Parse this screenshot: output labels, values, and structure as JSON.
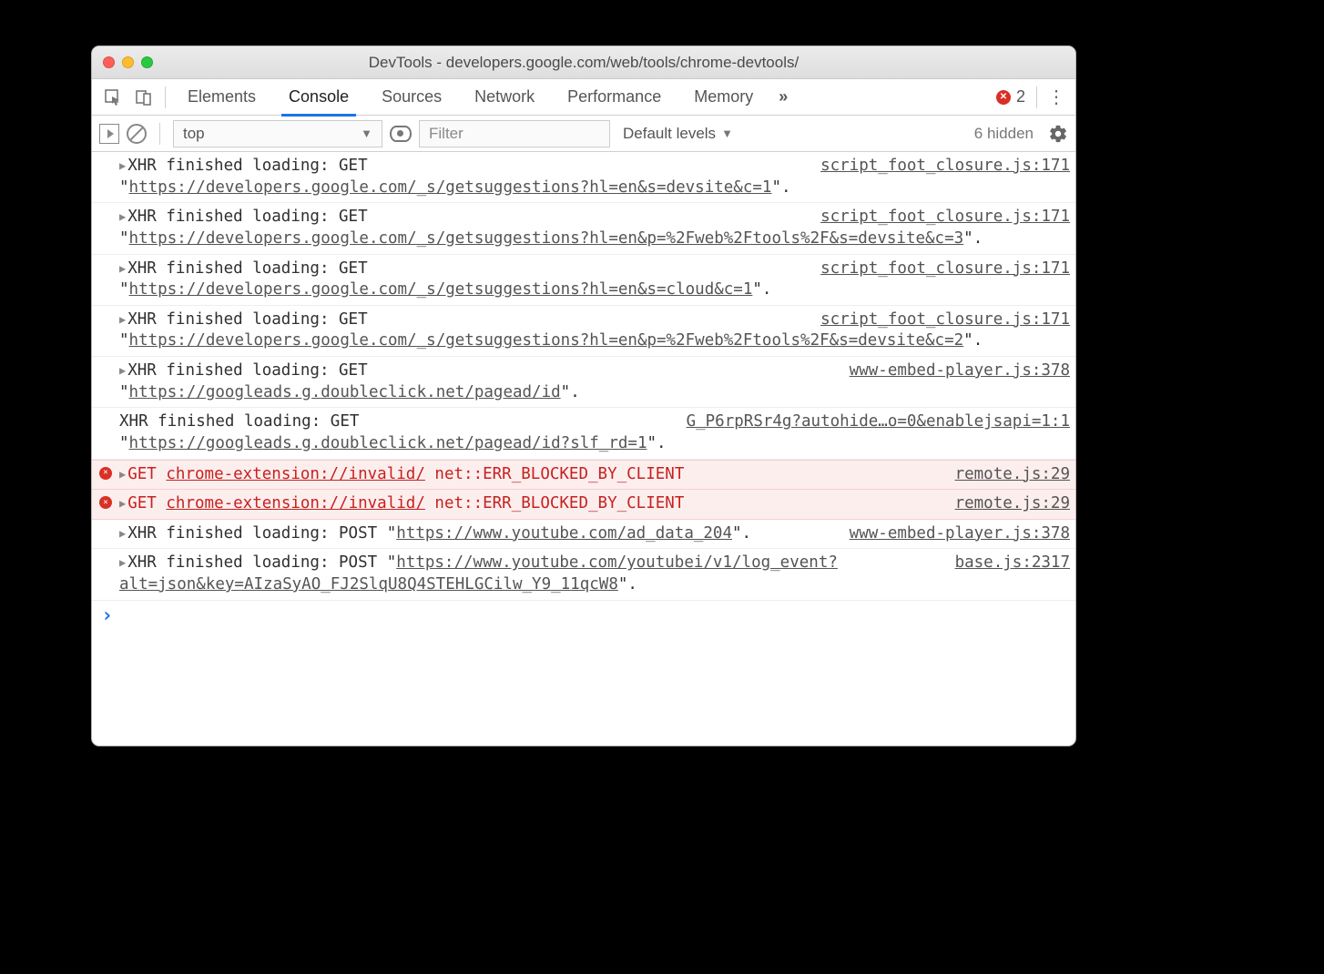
{
  "window": {
    "title": "DevTools - developers.google.com/web/tools/chrome-devtools/"
  },
  "tabs": {
    "items": [
      "Elements",
      "Console",
      "Sources",
      "Network",
      "Performance",
      "Memory"
    ],
    "active_index": 1,
    "overflow_glyph": "»",
    "error_count": "2"
  },
  "filter": {
    "context": "top",
    "context_arrow": "▼",
    "placeholder": "Filter",
    "levels_label": "Default levels",
    "levels_arrow": "▼",
    "hidden_label": "6 hidden"
  },
  "logs": [
    {
      "type": "xhr",
      "prefix": "XHR finished loading: GET \"",
      "url": "https://developers.google.com/_s/getsuggestions?hl=en&s=devsite&c=1",
      "suffix": "\".",
      "source": "script_foot_closure.js:171",
      "disclose": true
    },
    {
      "type": "xhr",
      "prefix": "XHR finished loading: GET \"",
      "url": "https://developers.google.com/_s/getsuggestions?hl=en&p=%2Fweb%2Ftools%2F&s=devsite&c=3",
      "suffix": "\".",
      "source": "script_foot_closure.js:171",
      "disclose": true
    },
    {
      "type": "xhr",
      "prefix": "XHR finished loading: GET \"",
      "url": "https://developers.google.com/_s/getsuggestions?hl=en&s=cloud&c=1",
      "suffix": "\".",
      "source": "script_foot_closure.js:171",
      "disclose": true
    },
    {
      "type": "xhr",
      "prefix": "XHR finished loading: GET \"",
      "url": "https://developers.google.com/_s/getsuggestions?hl=en&p=%2Fweb%2Ftools%2F&s=devsite&c=2",
      "suffix": "\".",
      "source": "script_foot_closure.js:171",
      "disclose": true
    },
    {
      "type": "xhr",
      "prefix": "XHR finished loading: GET \"",
      "url": "https://googleads.g.doubleclick.net/pagead/id",
      "suffix": "\".",
      "source": "www-embed-player.js:378",
      "disclose": true
    },
    {
      "type": "xhr",
      "prefix": "XHR finished loading: GET \"",
      "url": "https://googleads.g.doubleclick.net/pagead/id?slf_rd=1",
      "suffix": "\".",
      "source": "G_P6rpRSr4g?autohide…o=0&enablejsapi=1:1",
      "disclose": false
    },
    {
      "type": "error",
      "method": "GET",
      "url": "chrome-extension://invalid/",
      "reason": "net::ERR_BLOCKED_BY_CLIENT",
      "source": "remote.js:29",
      "disclose": true
    },
    {
      "type": "error",
      "method": "GET",
      "url": "chrome-extension://invalid/",
      "reason": "net::ERR_BLOCKED_BY_CLIENT",
      "source": "remote.js:29",
      "disclose": true
    },
    {
      "type": "xhr",
      "prefix": "XHR finished loading: POST \"",
      "url": "https://www.youtube.com/ad_data_204",
      "suffix": "\".",
      "source": "www-embed-player.js:378",
      "disclose": true
    },
    {
      "type": "xhr",
      "prefix": "XHR finished loading: POST \"",
      "url": "https://www.youtube.com/youtubei/v1/log_event?alt=json&key=AIzaSyAO_FJ2SlqU8Q4STEHLGCilw_Y9_11qcW8",
      "suffix": "\".",
      "source": "base.js:2317",
      "disclose": true
    }
  ]
}
